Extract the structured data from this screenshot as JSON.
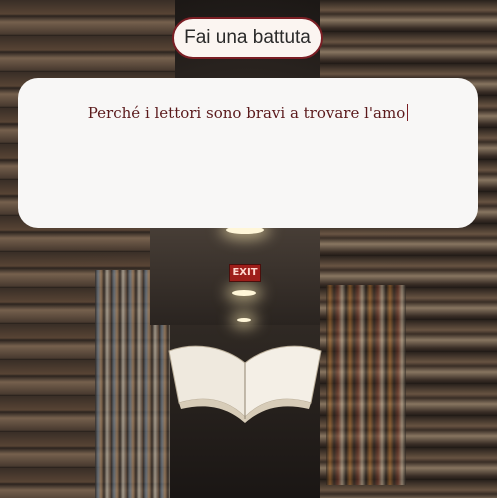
{
  "header": {
    "title": "Fai una battuta"
  },
  "editor": {
    "text": "Perché i lettori sono bravi a trovare l'amo"
  },
  "background": {
    "exit_sign": "EXIT"
  },
  "colors": {
    "accent": "#7a1e24",
    "card": "#f8f7f6",
    "text": "#5b1a1c"
  }
}
